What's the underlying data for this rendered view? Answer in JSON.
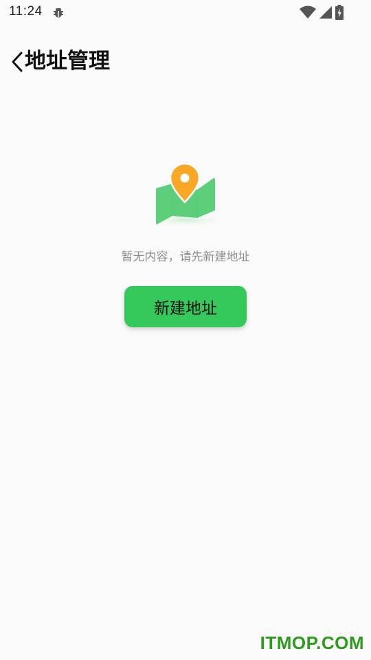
{
  "status_bar": {
    "time": "11:24",
    "icons": [
      "debug-bug-icon",
      "wifi-icon",
      "cell-signal-icon",
      "battery-charging-icon"
    ]
  },
  "header": {
    "back_icon": "chevron-left-icon",
    "title": "地址管理"
  },
  "empty_state": {
    "illustration": "map-pin-icon",
    "message": "暂无内容，请先新建地址",
    "button_label": "新建地址"
  },
  "watermark": "ITMOP.COM",
  "colors": {
    "accent": "#35c85b",
    "map_green": "#5dcf7a",
    "pin_orange": "#f9a825",
    "watermark": "#2f9b1e"
  }
}
